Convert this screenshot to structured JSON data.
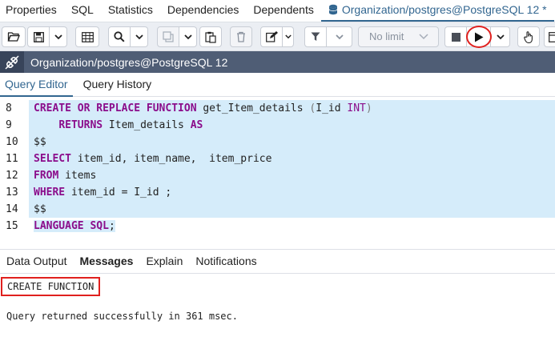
{
  "top_tabs": [
    "Properties",
    "SQL",
    "Statistics",
    "Dependencies",
    "Dependents"
  ],
  "active_tab": {
    "label": "Organization/postgres@PostgreSQL 12 *",
    "icon": "database-icon"
  },
  "toolbar": {
    "limit_label": "No limit",
    "buttons": [
      "open-file",
      "save",
      "save-dropdown",
      "grid",
      "find",
      "find-dropdown",
      "copy",
      "copy-dropdown",
      "paste",
      "delete",
      "edit",
      "edit-dropdown",
      "filter",
      "filter-dropdown",
      "stop",
      "execute",
      "execute-dropdown",
      "commit",
      "explain"
    ]
  },
  "connection": {
    "label": "Organization/postgres@PostgreSQL 12",
    "icon": "connection-icon"
  },
  "editor_tabs": [
    {
      "label": "Query Editor",
      "active": true
    },
    {
      "label": "Query History",
      "active": false
    }
  ],
  "editor": {
    "line_numbers": [
      "8",
      "9",
      "10",
      "11",
      "12",
      "13",
      "14",
      "15"
    ],
    "lines": [
      "CREATE OR REPLACE FUNCTION get_Item_details (I_id INT)",
      "    RETURNS Item_details AS",
      "$$",
      "SELECT item_id, item_name,  item_price",
      "FROM items",
      "WHERE item_id = I_id ;",
      "$$",
      "LANGUAGE SQL;"
    ]
  },
  "output_tabs": [
    {
      "label": "Data Output",
      "active": false
    },
    {
      "label": "Messages",
      "active": true
    },
    {
      "label": "Explain",
      "active": false
    },
    {
      "label": "Notifications",
      "active": false
    }
  ],
  "messages": {
    "line1": "CREATE FUNCTION",
    "line2": "Query returned successfully in 361 msec."
  },
  "colors": {
    "accent": "#326690",
    "connection_bar": "#4f5d75",
    "highlight": "#e0201e",
    "selection": "#d5ecfa",
    "keyword": "#8b0d8b"
  }
}
